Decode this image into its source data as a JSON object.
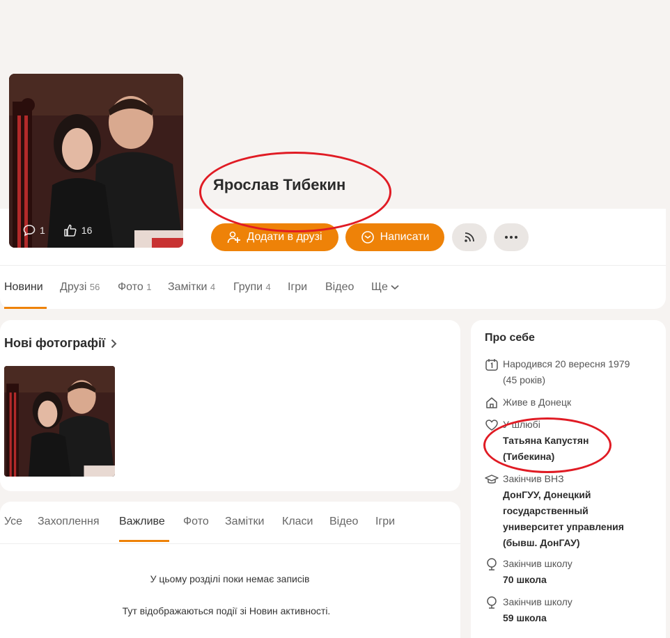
{
  "profile": {
    "name": "Ярослав Тибекин",
    "comments_count": "1",
    "likes_count": "16",
    "add_friend_label": "Додати в друзі",
    "write_label": "Написати"
  },
  "nav_tabs": [
    {
      "label": "Новини",
      "count": ""
    },
    {
      "label": "Друзі",
      "count": "56"
    },
    {
      "label": "Фото",
      "count": "1"
    },
    {
      "label": "Замітки",
      "count": "4"
    },
    {
      "label": "Групи",
      "count": "4"
    },
    {
      "label": "Ігри",
      "count": ""
    },
    {
      "label": "Відео",
      "count": ""
    },
    {
      "label": "Ще",
      "count": ""
    }
  ],
  "photos": {
    "title": "Нові фотографії"
  },
  "feed_tabs": [
    "Усе",
    "Захоплення",
    "Важливе",
    "Фото",
    "Замітки",
    "Класи",
    "Відео",
    "Ігри"
  ],
  "feed": {
    "empty_title": "У цьому розділі поки немає записів",
    "empty_sub": "Тут відображаються події зі Новин активності."
  },
  "about": {
    "title": "Про себе",
    "born": "Народився 20 вересня 1979",
    "age": "(45 років)",
    "lives": "Живе в Донецк",
    "married_label": "У шлюбі",
    "married_name": "Татьяна Капустян (Тибекина)",
    "uni_label": "Закінчив ВНЗ",
    "uni_name": "ДонГУУ, Донецкий государственный университет управления (бывш. ДонГАУ)",
    "school1_label": "Закінчив школу",
    "school1_name": "70 школа",
    "school2_label": "Закінчив школу",
    "school2_name": "59 школа"
  },
  "colors": {
    "accent": "#ee8208",
    "annotation": "#e01b24",
    "background": "#f6f3f1"
  }
}
